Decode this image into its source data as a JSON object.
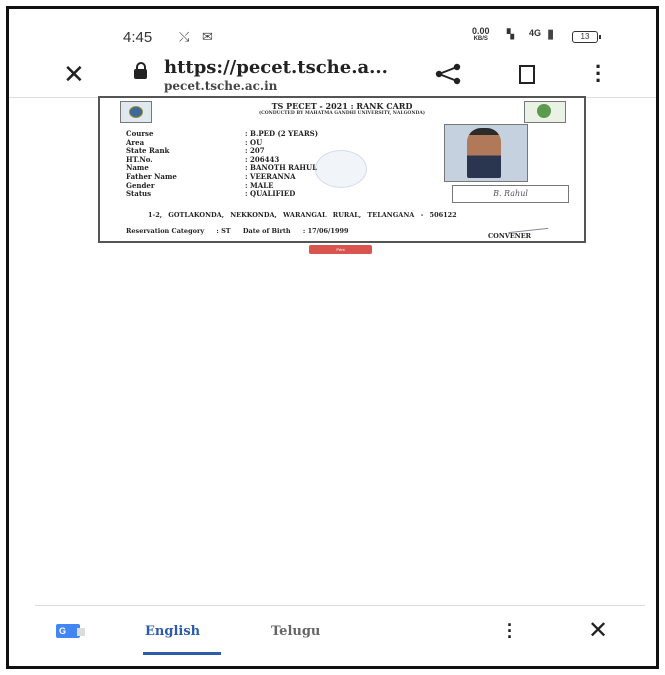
{
  "status_bar": {
    "time": "4:45",
    "speed_value": "0.00",
    "speed_unit": "KB/S",
    "network": "4G",
    "battery": "13"
  },
  "browser": {
    "url_title": "https://pecet.tsche.a...",
    "url_domain": "pecet.tsche.ac.in"
  },
  "rank_card": {
    "title": "TS PECET - 2021 : RANK CARD",
    "subtitle": "(CONDUCTED BY MAHATMA GANDHI UNIVERSITY, NALGONDA)",
    "fields": [
      {
        "label": "Course",
        "value": ": B.PED (2 YEARS)"
      },
      {
        "label": "Area",
        "value": ": OU"
      },
      {
        "label": "State Rank",
        "value": ": 207"
      },
      {
        "label": "HT.No.",
        "value": ": 206443"
      },
      {
        "label": "Name",
        "value": ": BANOTH RAHUL"
      },
      {
        "label": "Father Name",
        "value": ": VEERANNA"
      },
      {
        "label": "Gender",
        "value": ": MALE"
      },
      {
        "label": "Status",
        "value": ": QUALIFIED"
      }
    ],
    "signature": "B. Rahul",
    "address": "1-2, GOTLAKONDA, NEKKONDA, WARANGAL RURAL, TELANGANA - 506122",
    "reservation_label": "Reservation Category",
    "reservation_value": ": ST",
    "dob_label": "Date of Birth",
    "dob_value": ": 17/06/1999",
    "convener": "CONVENER",
    "print_label": "Print"
  },
  "translate_bar": {
    "tab_english": "English",
    "tab_telugu": "Telugu"
  },
  "colors": {
    "accent": "#2d5ca8",
    "print_button": "#d9534f"
  }
}
